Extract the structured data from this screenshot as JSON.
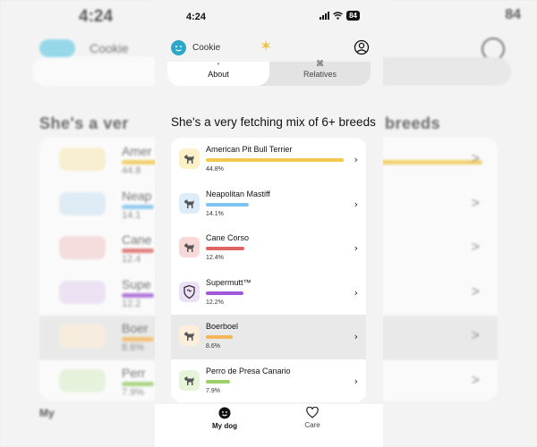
{
  "status": {
    "time": "4:24",
    "battery": "84"
  },
  "header": {
    "dog_name": "Cookie"
  },
  "tabs": [
    {
      "label": "About",
      "active": true
    },
    {
      "label": "Relatives",
      "active": false
    }
  ],
  "headline": "She's a very fetching mix of 6+ breeds",
  "breeds": [
    {
      "name": "American Pit Bull Terrier",
      "percent_text": "44.8%",
      "percent": 44.8,
      "color": "#f2c94c",
      "thumb_bg": "#fbf0c8",
      "icon": "dog-icon"
    },
    {
      "name": "Neapolitan Mastiff",
      "percent_text": "14.1%",
      "percent": 14.1,
      "color": "#7ec3ef",
      "thumb_bg": "#dcecf8",
      "icon": "dog-icon"
    },
    {
      "name": "Cane Corso",
      "percent_text": "12.4%",
      "percent": 12.4,
      "color": "#e06363",
      "thumb_bg": "#f8d9d9",
      "icon": "dog-icon"
    },
    {
      "name": "Supermutt™",
      "percent_text": "12.2%",
      "percent": 12.2,
      "color": "#a259d9",
      "thumb_bg": "#ece0f7",
      "icon": "shield-icon"
    },
    {
      "name": "Boerboel",
      "percent_text": "8.6%",
      "percent": 8.6,
      "color": "#f5b559",
      "thumb_bg": "#fbeedb",
      "icon": "dog-icon",
      "highlighted": true
    },
    {
      "name": "Perro de Presa Canario",
      "percent_text": "7.9%",
      "percent": 7.9,
      "color": "#9bd06b",
      "thumb_bg": "#e6f4d9",
      "icon": "dog-icon"
    }
  ],
  "bottom_tabs": [
    {
      "label": "My dog",
      "icon": "dog-face-icon",
      "active": true
    },
    {
      "label": "Care",
      "icon": "heart-icon",
      "active": false
    }
  ]
}
